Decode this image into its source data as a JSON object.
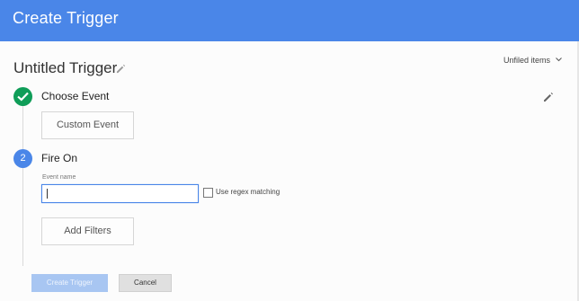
{
  "header": {
    "title": "Create Trigger"
  },
  "trigger": {
    "name": "Untitled Trigger",
    "folder_label": "Unfiled items"
  },
  "steps": {
    "choose_event": {
      "title": "Choose Event",
      "selected_event": "Custom Event"
    },
    "fire_on": {
      "number": "2",
      "title": "Fire On",
      "event_name_label": "Event name",
      "event_name_value": "",
      "regex_label": "Use regex matching",
      "regex_checked": false,
      "add_filters_label": "Add Filters"
    }
  },
  "footer": {
    "create_label": "Create Trigger",
    "cancel_label": "Cancel"
  },
  "colors": {
    "header_bg": "#4a86e8",
    "step_done": "#0f9d58",
    "step_active": "#4a86e8",
    "primary_disabled": "#a8c6f2"
  },
  "icons": {
    "title_edit": "pencil-icon",
    "step_done": "check-icon",
    "section_edit": "pencil-icon",
    "folder_menu": "chevron-down-icon"
  }
}
